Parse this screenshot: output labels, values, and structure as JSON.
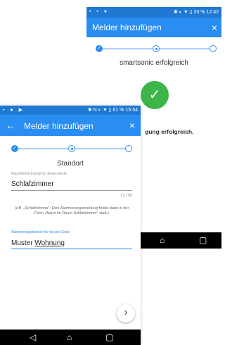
{
  "back_screen": {
    "status": {
      "icons": "▪ ▪ ●",
      "right_icons": "✱ ◐ ▼ ▯",
      "battery": "33 %",
      "time": "12:42"
    },
    "appbar": {
      "title": "Melder hinzufügen",
      "close_icon": "close-icon"
    },
    "step_title": "smartsonic erfolgreich",
    "check_glyph": "✓",
    "message_tail": "gung erfolgreich.",
    "nav": {
      "home": "⌂",
      "recent": "▢"
    }
  },
  "front_screen": {
    "status": {
      "icons": "▪ ● ▶",
      "right_icons": "✱ N ◐ ▼ ▯",
      "battery": "61 %",
      "time": "15:54"
    },
    "appbar": {
      "title": "Melder hinzufügen",
      "back": "←",
      "close": "×"
    },
    "step_title": "Standort",
    "room_field": {
      "label": "Raumbezeichnung für dieses Gerät",
      "value": "Schlafzimmer",
      "counter": "12 / 50"
    },
    "hint": "(z.B. „Schlafzimmer“: Eine Alarmierungsmeldung findet dann in der Form „Alarm im Raum Schlafzimmer“ statt.)",
    "area_field": {
      "label": "Alarmierungsbereich für dieses Gerät",
      "value_part1": "Muster ",
      "value_part2": "Wohnung"
    },
    "next_glyph": "›",
    "nav": {
      "back": "◁",
      "home": "⌂",
      "recent": "▢"
    }
  },
  "colors": {
    "primary": "#2a8df2",
    "success": "#3cb54a",
    "statusbar_dark": "#1f78d1"
  }
}
